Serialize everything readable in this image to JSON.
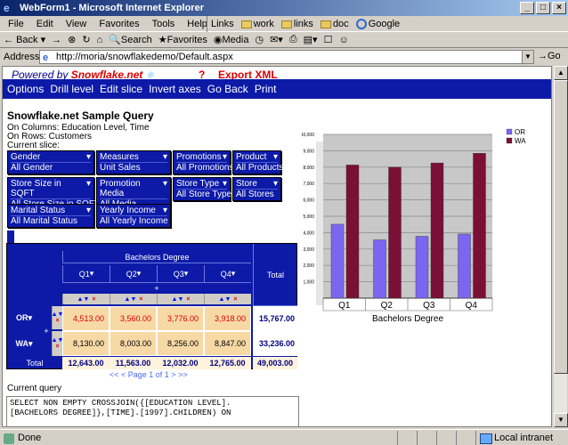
{
  "window": {
    "title": "WebForm1 - Microsoft Internet Explorer"
  },
  "menu": [
    "File",
    "Edit",
    "View",
    "Favorites",
    "Tools",
    "Help"
  ],
  "links": {
    "label": "Links",
    "items": [
      "work",
      "links",
      "doc",
      "Google"
    ]
  },
  "toolbar": {
    "back": "Back",
    "forward": "→",
    "search": "Search",
    "favorites": "Favorites",
    "media": "Media"
  },
  "address": {
    "label": "Address",
    "url": "http://moria/snowflakedemo/Default.aspx",
    "go": "Go"
  },
  "status": {
    "text": "Done",
    "zone": "Local intranet"
  },
  "page": {
    "powered_by": "Powered by",
    "brand": "Snowflake.net",
    "help": "?",
    "export": "Export XML",
    "nav": [
      "Options",
      "Drill level",
      "Edit slice",
      "Invert axes",
      "Go Back",
      "Print"
    ],
    "title": "Snowflake.net Sample Query",
    "columns_text": "On Columns: Education Level, Time",
    "rows_text": "On Rows: Customers",
    "slice_text": "Current slice:",
    "slicers": [
      {
        "label": "Gender",
        "value": "All Gender"
      },
      {
        "label": "Measures",
        "value": "Unit Sales"
      },
      {
        "label": "Promotions",
        "value": "All Promotions"
      },
      {
        "label": "Product",
        "value": "All Products"
      },
      {
        "label": "Store Size in SQFT",
        "value": "All Store Size in SQFT"
      },
      {
        "label": "Promotion Media",
        "value": "All Media"
      },
      {
        "label": "Store Type",
        "value": "All Store Type"
      },
      {
        "label": "Store",
        "value": "All Stores"
      },
      {
        "label": "Marital Status",
        "value": "All Marital Status"
      },
      {
        "label": "Yearly Income",
        "value": "All Yearly Income"
      }
    ],
    "query_label": "Current query",
    "query_lines": [
      "SELECT NON EMPTY CROSSJOIN({[EDUCATION LEVEL].",
      "[BACHELORS DEGREE]},[TIME].[1997].CHILDREN) ON"
    ]
  },
  "pivot": {
    "col_group": "Bachelors Degree",
    "quarters": [
      "Q1",
      "Q2",
      "Q3",
      "Q4"
    ],
    "total_label": "Total",
    "plus": "+",
    "rows": [
      {
        "name": "OR",
        "values": [
          "4,513.00",
          "3,560.00",
          "3,776.00",
          "3,918.00"
        ],
        "total": "15,767.00"
      },
      {
        "name": "WA",
        "values": [
          "8,130.00",
          "8,003.00",
          "8,256.00",
          "8,847.00"
        ],
        "total": "33,236.00"
      }
    ],
    "totals": {
      "label": "Total",
      "values": [
        "12,643.00",
        "11,563.00",
        "12,032.00",
        "12,765.00"
      ],
      "grand": "49,003.00"
    },
    "pager": "<< < Page 1 of 1 > >>"
  },
  "chart_data": {
    "type": "bar",
    "categories": [
      "Q1",
      "Q2",
      "Q3",
      "Q4"
    ],
    "xlabel": "Bachelors Degree",
    "ylim": [
      0,
      10000
    ],
    "yticks": [
      "1,000",
      "2,000",
      "3,000",
      "4,000",
      "5,000",
      "6,000",
      "7,000",
      "8,000",
      "9,000",
      "10,000"
    ],
    "series": [
      {
        "name": "OR",
        "values": [
          4513,
          3560,
          3776,
          3918
        ],
        "color": "#7a66f0"
      },
      {
        "name": "WA",
        "values": [
          8130,
          8003,
          8256,
          8847
        ],
        "color": "#7a1035"
      }
    ],
    "legend": "top-right",
    "grid": true
  }
}
